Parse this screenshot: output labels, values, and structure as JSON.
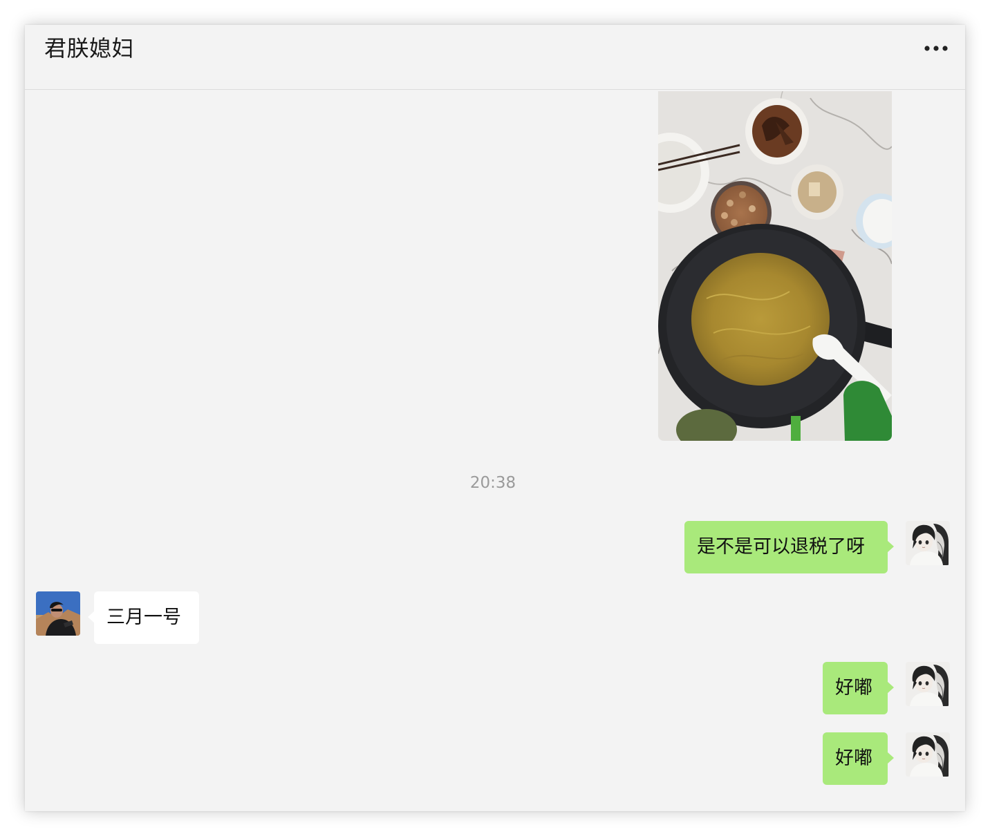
{
  "chat": {
    "title": "君朕媳妇",
    "more_icon": "more-horizontal-icon"
  },
  "messages": [
    {
      "sender": "me",
      "type": "image",
      "content": "photo of noodle pan, peanuts and side dishes on a marble table"
    },
    {
      "type": "timestamp",
      "text": "20:38"
    },
    {
      "sender": "me",
      "type": "text",
      "text": "是不是可以退税了呀"
    },
    {
      "sender": "contact",
      "type": "text",
      "text": "三月一号"
    },
    {
      "sender": "me",
      "type": "text",
      "text": "好嘟"
    },
    {
      "sender": "me",
      "type": "text",
      "text": "好嘟"
    }
  ],
  "colors": {
    "background": "#f3f3f3",
    "outgoing_bubble": "#a9e97b",
    "incoming_bubble": "#ffffff",
    "timestamp_text": "#9a9a9a"
  }
}
